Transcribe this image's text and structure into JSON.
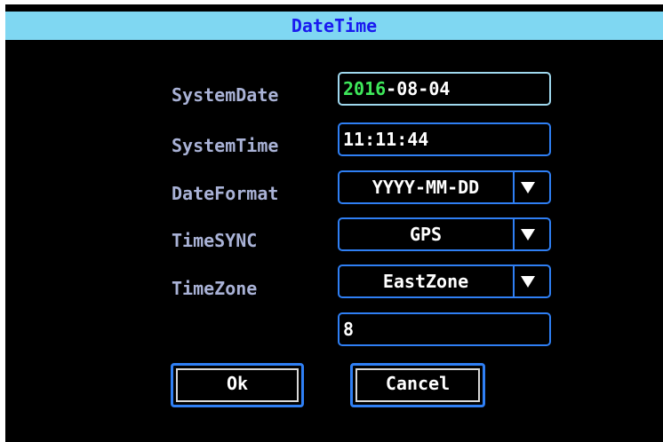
{
  "dialog": {
    "title": "DateTime"
  },
  "fields": {
    "system_date": {
      "label": "SystemDate",
      "value_year": "2016",
      "value_rest": "-08-04"
    },
    "system_time": {
      "label": "SystemTime",
      "value": "11:11:44"
    },
    "date_format": {
      "label": "DateFormat",
      "value": "YYYY-MM-DD"
    },
    "time_sync": {
      "label": "TimeSYNC",
      "value": "GPS"
    },
    "time_zone": {
      "label": "TimeZone",
      "value": "EastZone"
    },
    "zone_offset": {
      "value": "8"
    }
  },
  "buttons": {
    "ok": "Ok",
    "cancel": "Cancel"
  },
  "colors": {
    "title_bar": "#7fd7f2",
    "title_text": "#1a1af0",
    "label_text": "#a9b2d6",
    "border": "#2f7ff4",
    "focus_border": "#9fd8ee",
    "highlight": "#3ee85a",
    "background": "#000000"
  },
  "icons": {
    "dropdown": "triangle-down-icon"
  }
}
